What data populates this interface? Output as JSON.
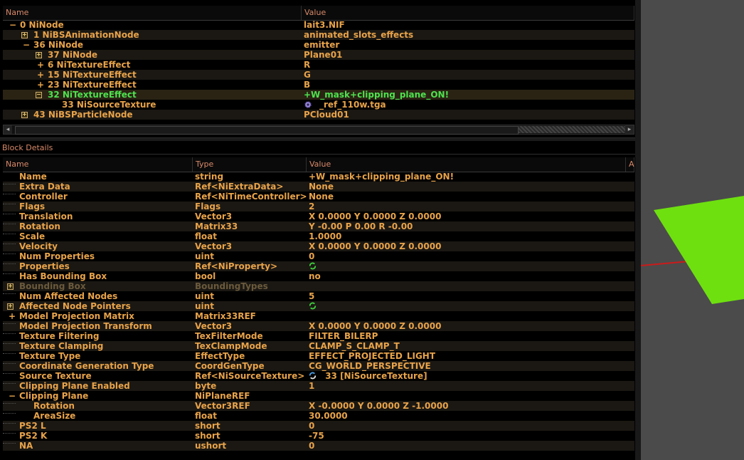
{
  "tree": {
    "headers": [
      "Name",
      "Value"
    ],
    "rows": [
      {
        "name": "0 NiNode",
        "value": "lait3.NIF"
      },
      {
        "name": "1 NiBSAnimationNode",
        "value": "animated_slots_effects"
      },
      {
        "name": "36 NiNode",
        "value": "emitter"
      },
      {
        "name": "37 NiNode",
        "value": "Plane01"
      },
      {
        "name": "6 NiTextureEffect",
        "value": "R"
      },
      {
        "name": "15 NiTextureEffect",
        "value": "G"
      },
      {
        "name": "23 NiTextureEffect",
        "value": "B"
      },
      {
        "name": "32 NiTextureEffect",
        "value": "+W_mask+clipping_plane_ON!"
      },
      {
        "name": "33 NiSourceTexture",
        "value": "_ref_110w.tga"
      },
      {
        "name": "43 NiBSParticleNode",
        "value": "PCloud01"
      }
    ]
  },
  "block_details": {
    "title": "Block Details",
    "headers": [
      "Name",
      "Type",
      "Value",
      "A"
    ],
    "rows": [
      {
        "name": "Name",
        "type": "string",
        "value": "+W_mask+clipping_plane_ON!"
      },
      {
        "name": "Extra Data",
        "type": "Ref<NiExtraData>",
        "value": "None"
      },
      {
        "name": "Controller",
        "type": "Ref<NiTimeController>",
        "value": "None"
      },
      {
        "name": "Flags",
        "type": "Flags",
        "value": "2"
      },
      {
        "name": "Translation",
        "type": "Vector3",
        "value": "X 0.0000 Y 0.0000 Z 0.0000"
      },
      {
        "name": "Rotation",
        "type": "Matrix33",
        "value": "Y -0.00 P 0.00 R -0.00"
      },
      {
        "name": "Scale",
        "type": "float",
        "value": "1.0000"
      },
      {
        "name": "Velocity",
        "type": "Vector3",
        "value": "X 0.0000 Y 0.0000 Z 0.0000"
      },
      {
        "name": "Num Properties",
        "type": "uint",
        "value": "0"
      },
      {
        "name": "Properties",
        "type": "Ref<NiProperty>",
        "value": ""
      },
      {
        "name": "Has Bounding Box",
        "type": "bool",
        "value": "no"
      },
      {
        "name": "Bounding Box",
        "type": "BoundingTypes",
        "value": ""
      },
      {
        "name": "Num Affected Nodes",
        "type": "uint",
        "value": "5"
      },
      {
        "name": "Affected Node Pointers",
        "type": "uint",
        "value": ""
      },
      {
        "name": "Model Projection Matrix",
        "type": "Matrix33REF",
        "value": ""
      },
      {
        "name": "Model Projection Transform",
        "type": "Vector3",
        "value": "X 0.0000 Y 0.0000 Z 0.0000"
      },
      {
        "name": "Texture Filtering",
        "type": "TexFilterMode",
        "value": "FILTER_BILERP"
      },
      {
        "name": "Texture Clamping",
        "type": "TexClampMode",
        "value": "CLAMP_S_CLAMP_T"
      },
      {
        "name": "Texture Type",
        "type": "EffectType",
        "value": "EFFECT_PROJECTED_LIGHT"
      },
      {
        "name": "Coordinate Generation Type",
        "type": "CoordGenType",
        "value": "CG_WORLD_PERSPECTIVE"
      },
      {
        "name": "Source Texture",
        "type": "Ref<NiSourceTexture>",
        "value": "33 [NiSourceTexture]"
      },
      {
        "name": "Clipping Plane Enabled",
        "type": "byte",
        "value": "1"
      },
      {
        "name": "Clipping Plane",
        "type": "NiPlaneREF",
        "value": ""
      },
      {
        "name": "Rotation",
        "type": "Vector3REF",
        "value": "X -0.0000 Y 0.0000 Z -1.0000"
      },
      {
        "name": "AreaSize",
        "type": "float",
        "value": "30.0000"
      },
      {
        "name": "PS2 L",
        "type": "short",
        "value": "0"
      },
      {
        "name": "PS2 K",
        "type": "short",
        "value": "-75"
      },
      {
        "name": "NA",
        "type": "ushort",
        "value": "0"
      }
    ]
  },
  "colors": {
    "text": "#e8a34a",
    "selected_text": "#4ee24e",
    "viewport_bg": "#4b4b4b",
    "plane": "#6ee010",
    "axis": "#cc1a1a"
  }
}
